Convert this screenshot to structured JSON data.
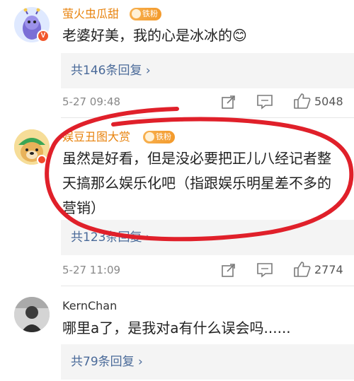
{
  "comments": [
    {
      "username": "萤火虫瓜甜",
      "fan_badge": "铁粉",
      "verified_badge": "V",
      "text": "老婆好美，我的心是冰冰的😊",
      "replies_label": "共146条回复 ›",
      "timestamp": "5-27 09:48",
      "likes": "5048"
    },
    {
      "username": "娱豆丑图大赏",
      "fan_badge": "铁粉",
      "text_lines": [
        "虽然是好看，但是没必要把正儿八经记者整",
        "天搞那么娱乐化吧（指跟娱乐明星差不多的",
        "营销）"
      ],
      "replies_label": "共123条回复 ›",
      "timestamp": "5-27 11:09",
      "likes": "2774"
    },
    {
      "username": "KernChan",
      "text": "哪里a了，是我对a有什么误会吗......",
      "replies_label": "共79条回复 ›"
    }
  ],
  "icons": [
    "share-icon",
    "comment-icon",
    "like-icon",
    "fan-badge-icon",
    "verified-badge-icon"
  ],
  "colors": {
    "username": "#e8830e",
    "reply_link": "#4a6a99",
    "annotation": "#e0202a",
    "reply_bg": "#f4f4f4"
  }
}
